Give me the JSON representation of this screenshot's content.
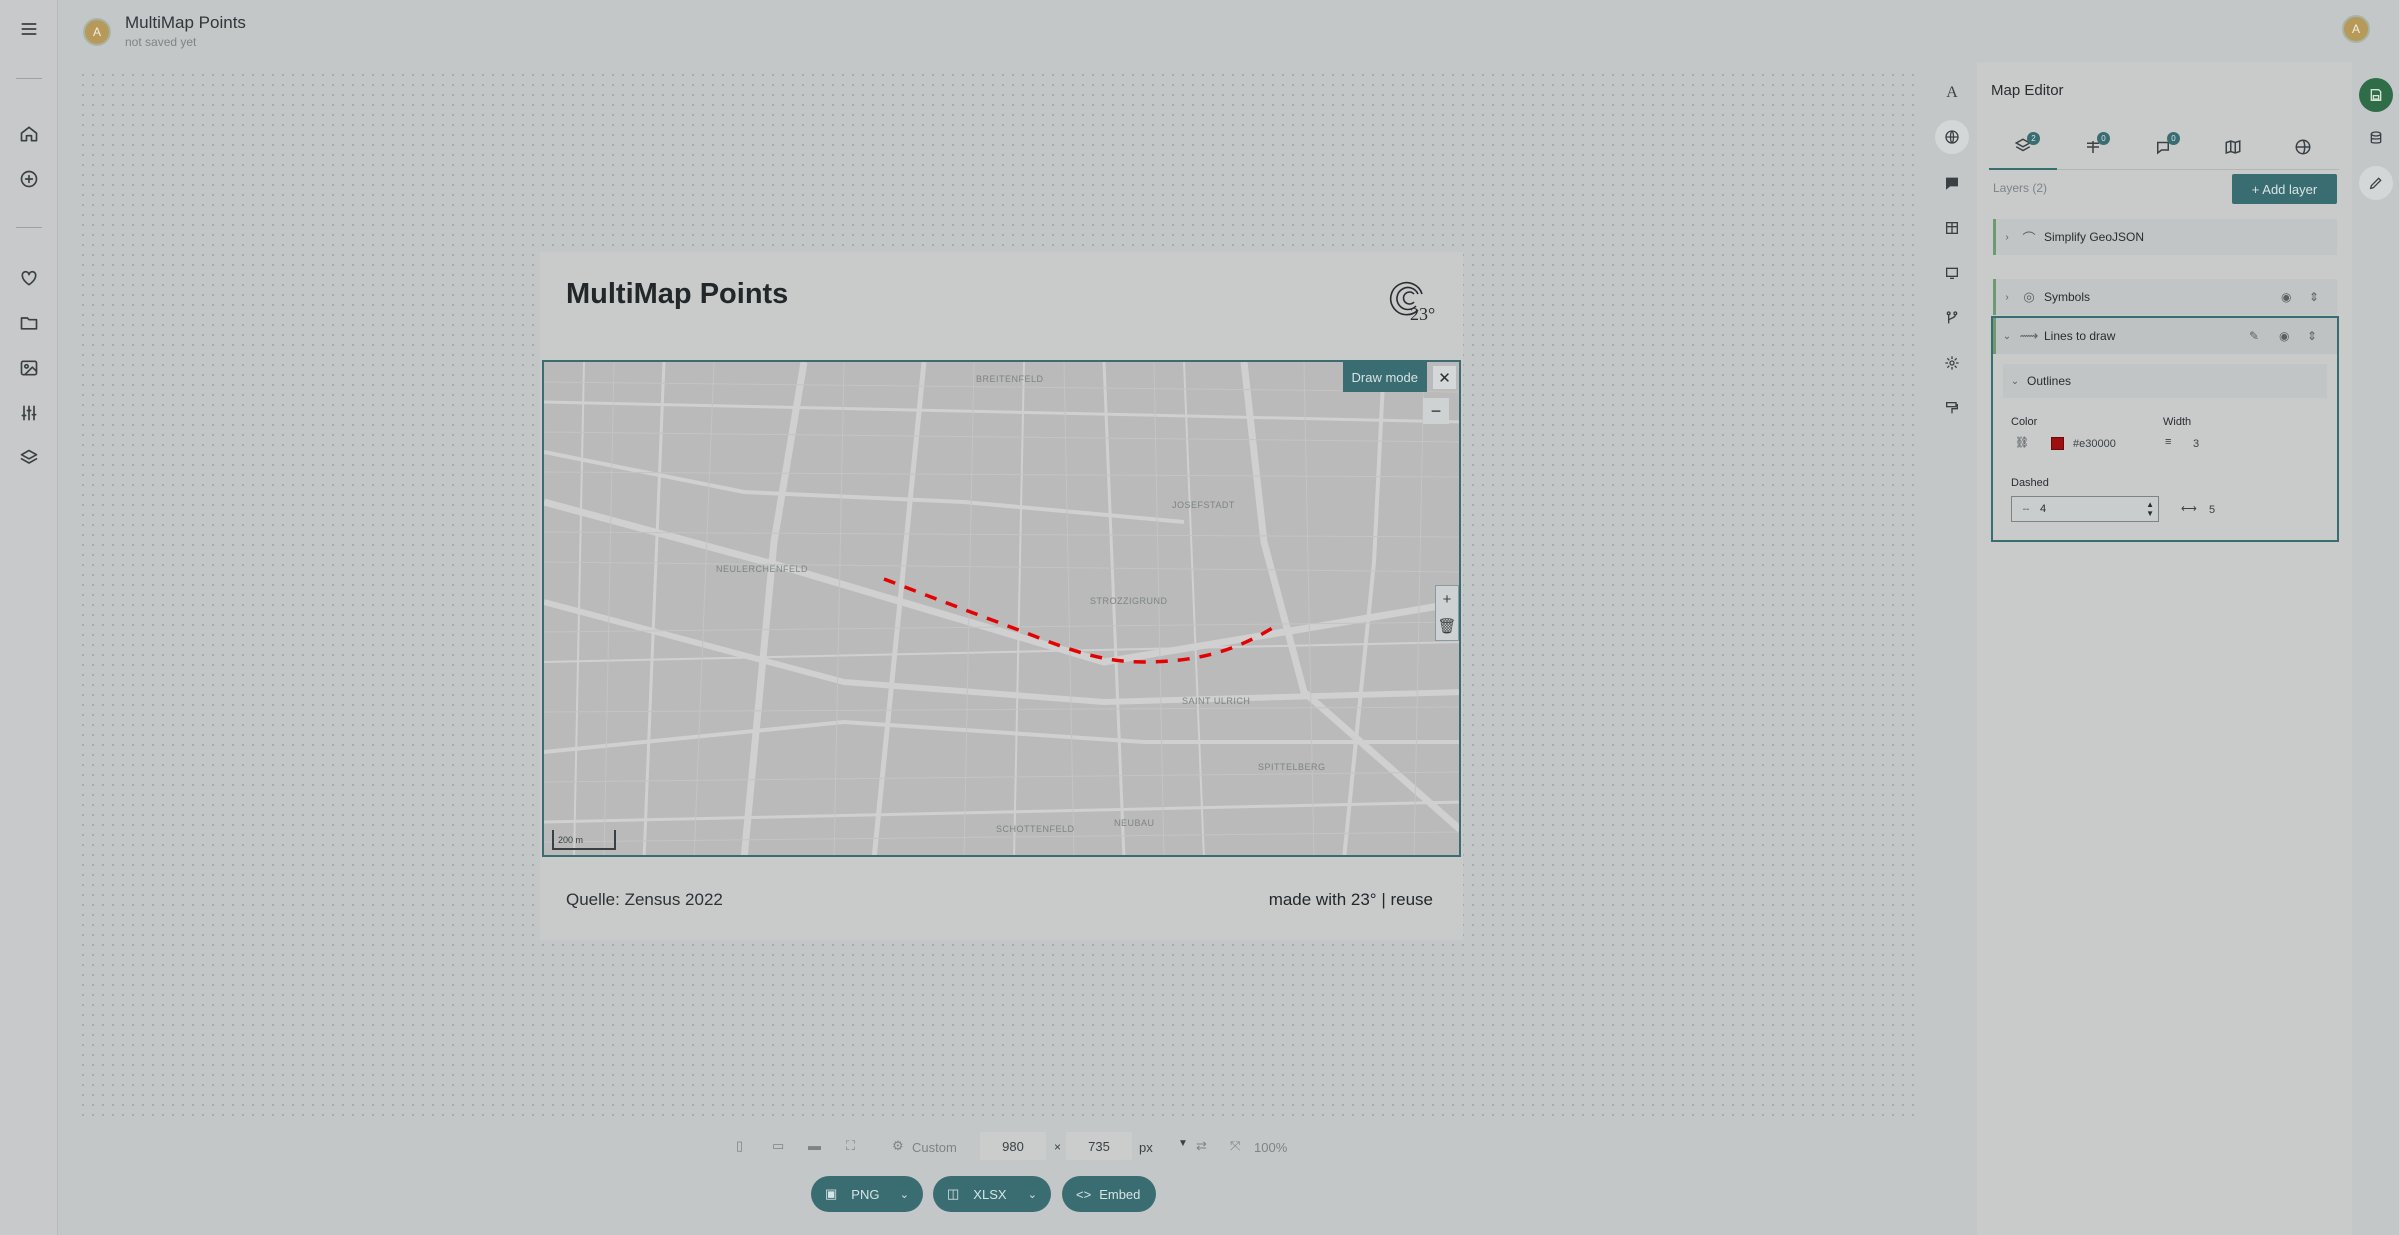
{
  "header": {
    "avatar_initial": "A",
    "title": "MultiMap Points",
    "subtitle": "not saved yet",
    "user_initial": "A"
  },
  "left_nav": {
    "icons": [
      "menu-icon",
      "home-icon",
      "plus-circle-icon",
      "heart-icon",
      "folder-icon",
      "image-icon",
      "sliders-icon",
      "layers-icon"
    ]
  },
  "card": {
    "title": "MultiMap Points",
    "logo_text": "23°",
    "source": "Quelle: Zensus 2022",
    "made_with": "made with 23° | reuse"
  },
  "map": {
    "draw_mode_label": "Draw mode",
    "close_glyph": "✕",
    "zoom_minus": "−",
    "draw_add": "+",
    "draw_delete": "🗑",
    "scale_label": "200 m",
    "line_color": "#e30000",
    "labels": [
      "BREITENFELD",
      "JOSEFSTADT",
      "NEULERCHENFELD",
      "STROZZIGRUND",
      "SAINT ULRICH",
      "SPITTELBERG",
      "SCHOTTENFELD",
      "NEUBAU"
    ]
  },
  "panel": {
    "title": "Map Editor",
    "tabs": [
      {
        "icon": "layers-icon",
        "badge": "2"
      },
      {
        "icon": "filter-icon",
        "badge": "0"
      },
      {
        "icon": "chat-icon",
        "badge": "0"
      },
      {
        "icon": "map-icon",
        "badge": ""
      },
      {
        "icon": "globe-icon",
        "badge": ""
      }
    ],
    "layers_count": "Layers (2)",
    "add_layer": "+ Add layer",
    "layers": [
      {
        "name": "Simplify GeoJSON"
      },
      {
        "name": "Symbols"
      },
      {
        "name": "Lines to draw"
      }
    ],
    "outlines_label": "Outlines",
    "color_label": "Color",
    "color_value": "#e30000",
    "width_label": "Width",
    "width_value": "3",
    "dashed_label": "Dashed",
    "dashed_value": "4",
    "gap_value": "5"
  },
  "bottom": {
    "preset": "Custom",
    "width": "980",
    "times": "×",
    "height": "735",
    "unit": "px",
    "zoom": "100%",
    "png_label": "PNG",
    "xlsx_label": "XLSX",
    "embed_label": "Embed"
  }
}
